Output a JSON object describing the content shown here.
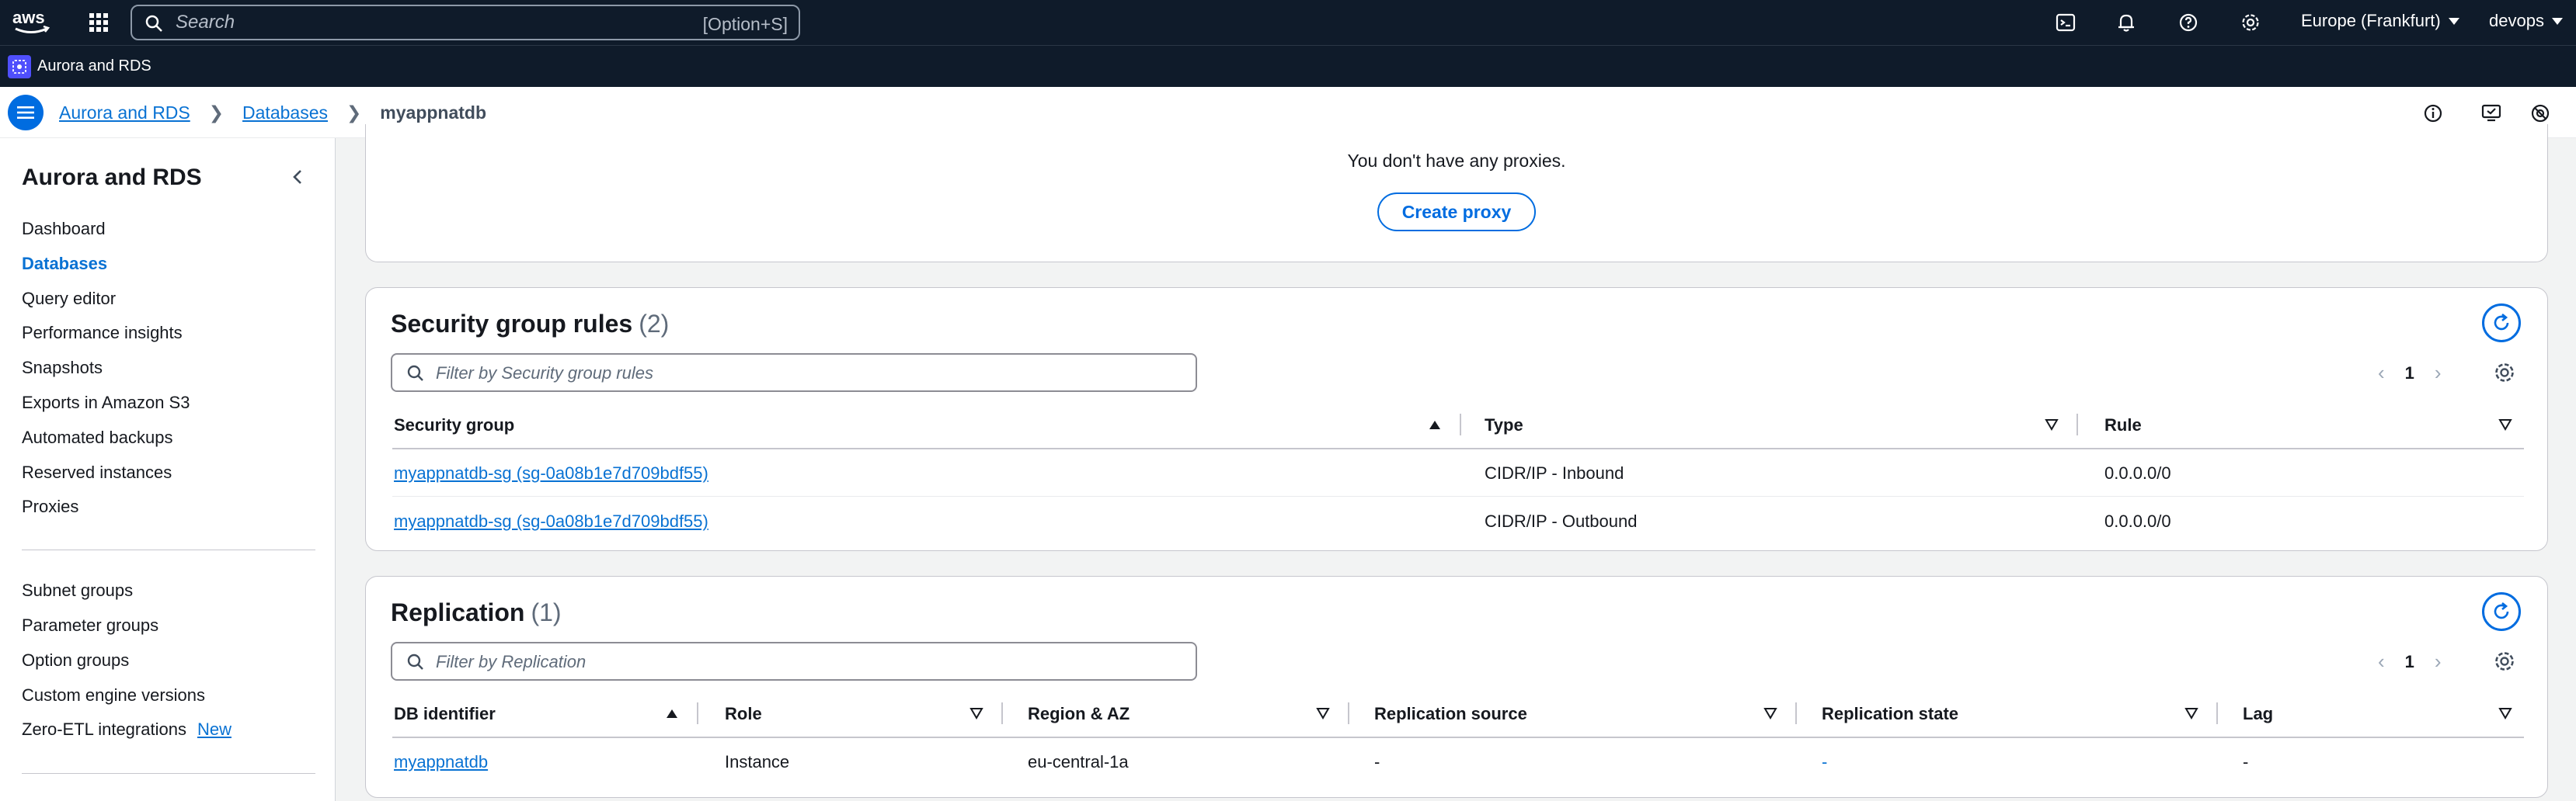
{
  "topnav": {
    "logo_text": "aws",
    "search_placeholder": "Search",
    "search_shortcut": "[Option+S]",
    "region": "Europe (Frankfurt)",
    "user": "devops"
  },
  "service": {
    "name": "Aurora and RDS"
  },
  "breadcrumb": {
    "items": [
      "Aurora and RDS",
      "Databases"
    ],
    "current": "myappnatdb"
  },
  "sidebar": {
    "title": "Aurora and RDS",
    "items": [
      "Dashboard",
      "Databases",
      "Query editor",
      "Performance insights",
      "Snapshots",
      "Exports in Amazon S3",
      "Automated backups",
      "Reserved instances",
      "Proxies"
    ],
    "items2": [
      "Subnet groups",
      "Parameter groups",
      "Option groups",
      "Custom engine versions",
      "Zero-ETL integrations"
    ],
    "new_badge": "New"
  },
  "proxies": {
    "empty_text": "You don't have any proxies.",
    "create_label": "Create proxy"
  },
  "security_rules": {
    "title": "Security group rules",
    "count": "(2)",
    "filter_placeholder": "Filter by Security group rules",
    "page": "1",
    "columns": [
      "Security group",
      "Type",
      "Rule"
    ],
    "rows": [
      {
        "group": "myappnatdb-sg (sg-0a08b1e7d709bdf55)",
        "type": "CIDR/IP - Inbound",
        "rule": "0.0.0.0/0"
      },
      {
        "group": "myappnatdb-sg (sg-0a08b1e7d709bdf55)",
        "type": "CIDR/IP - Outbound",
        "rule": "0.0.0.0/0"
      }
    ]
  },
  "replication": {
    "title": "Replication",
    "count": "(1)",
    "filter_placeholder": "Filter by Replication",
    "page": "1",
    "columns": [
      "DB identifier",
      "Role",
      "Region & AZ",
      "Replication source",
      "Replication state",
      "Lag"
    ],
    "rows": [
      {
        "db": "myappnatdb",
        "role": "Instance",
        "region": "eu-central-1a",
        "source": "-",
        "state": "-",
        "lag": "-"
      }
    ]
  },
  "colors": {
    "nav_bg": "#0f1b2a",
    "link": "#0972d3",
    "primary": "#006ce0",
    "page_bg": "#f2f3f3"
  },
  "icons": [
    "aws-logo",
    "apps-grid-icon",
    "search-icon",
    "cloudshell-icon",
    "bell-icon",
    "help-icon",
    "gear-icon",
    "rds-service-icon",
    "hamburger-icon",
    "info-icon",
    "feedback-icon",
    "settings-icon",
    "chevron-left-icon",
    "refresh-icon",
    "sort-icon"
  ]
}
